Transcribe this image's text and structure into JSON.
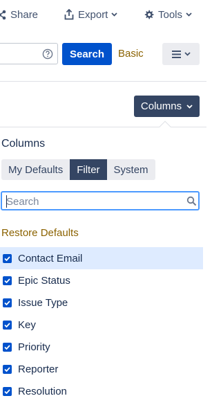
{
  "toolbar": {
    "share_label": "Share",
    "export_label": "Export",
    "tools_label": "Tools"
  },
  "search": {
    "button_label": "Search",
    "basic_label": "Basic"
  },
  "columns_button": {
    "label": "Columns"
  },
  "popup": {
    "title": "Columns",
    "tabs": [
      {
        "label": "My Defaults",
        "active": false
      },
      {
        "label": "Filter",
        "active": true
      },
      {
        "label": "System",
        "active": false
      }
    ],
    "filter_placeholder": "Search",
    "restore_label": "Restore Defaults",
    "items": [
      {
        "label": "Contact Email",
        "checked": true,
        "highlighted": true
      },
      {
        "label": "Epic Status",
        "checked": true,
        "highlighted": false
      },
      {
        "label": "Issue Type",
        "checked": true,
        "highlighted": false
      },
      {
        "label": "Key",
        "checked": true,
        "highlighted": false
      },
      {
        "label": "Priority",
        "checked": true,
        "highlighted": false
      },
      {
        "label": "Reporter",
        "checked": true,
        "highlighted": false
      },
      {
        "label": "Resolution",
        "checked": true,
        "highlighted": false
      }
    ]
  },
  "colors": {
    "primary": "#0052cc",
    "dark_button": "#344563",
    "link": "#8b6200",
    "highlight": "#deebff",
    "focus_border": "#4c9aff"
  }
}
